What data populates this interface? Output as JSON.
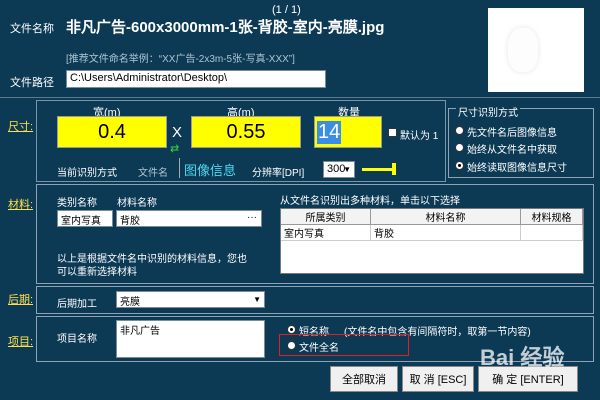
{
  "header": {
    "counter": "(1 / 1)",
    "file_name_label": "文件名称",
    "file_name_value": "非凡广告-600x3000mm-1张-背胶-室内-亮膜.jpg",
    "hint": "[推荐文件命名举例：“XX广告-2x3m-5张-写真-XXX”]",
    "file_path_label": "文件路径",
    "file_path_value": "C:\\Users\\Administrator\\Desktop\\"
  },
  "size": {
    "section_label": "尺寸:",
    "width_label": "宽(m)",
    "width_value": "0.4",
    "times": "X",
    "height_label": "高(m)",
    "height_value": "0.55",
    "qty_label": "数量",
    "qty_value": "14",
    "default_one_label": "默认为 1",
    "current_mode_label": "当前识别方式",
    "mode_filename": "文件名",
    "mode_image": "图像信息",
    "resolution_label": "分辨率[DPI]",
    "resolution_value": "300"
  },
  "size_mode": {
    "title": "尺寸识别方式",
    "options": [
      "先文件名后图像信息",
      "始终从文件名中获取",
      "始终读取图像信息尺寸"
    ],
    "selected": 2
  },
  "material": {
    "section_label": "材料:",
    "category_label": "类别名称",
    "material_label": "材料名称",
    "category_value": "室内写真",
    "material_value": "背胶",
    "multi_hint": "从文件名识别出多种材料，单击以下选择",
    "columns": [
      "所属类别",
      "材料名称",
      "材料规格"
    ],
    "rows": [
      [
        "室内写真",
        "背胶",
        ""
      ]
    ],
    "note_line1": "以上是根据文件名中识别的材料信息，您也",
    "note_line2": "可以重新选择材料"
  },
  "post": {
    "section_label": "后期:",
    "label": "后期加工",
    "value": "亮膜"
  },
  "project": {
    "section_label": "项目:",
    "label": "项目名称",
    "value": "非凡广告",
    "option_short": "短名称",
    "option_short_note": "(文件名中包含有间隔符时，取第一节内容)",
    "option_full": "文件全名"
  },
  "buttons": {
    "cancel_all": "全部取消",
    "cancel": "取 消 [ESC]",
    "confirm": "确 定 [ENTER]"
  },
  "watermark": "Bai 经验"
}
